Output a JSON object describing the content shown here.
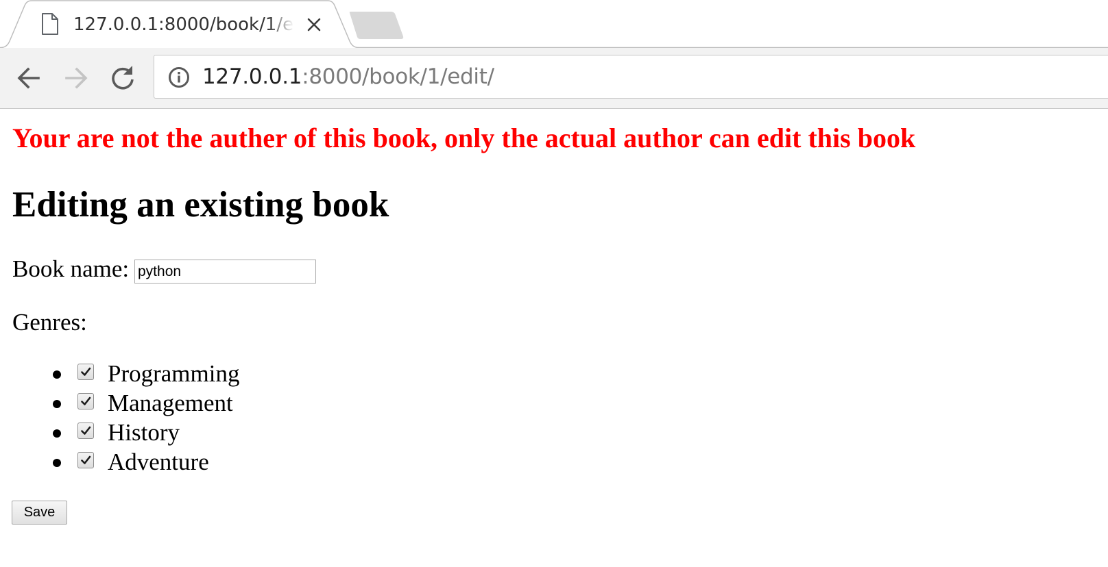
{
  "browser": {
    "tab": {
      "title": "127.0.0.1:8000/book/1/edit/",
      "icon": "file-icon",
      "close_icon": "close-icon"
    },
    "new_tab_icon": "new-tab-icon",
    "toolbar": {
      "back_icon": "back-arrow-icon",
      "forward_icon": "forward-arrow-icon",
      "reload_icon": "reload-icon"
    },
    "address_bar": {
      "info_icon": "info-icon",
      "url_host": "127.0.0.1",
      "url_rest": ":8000/book/1/edit/"
    }
  },
  "page": {
    "error_message": "Your are not the auther of this book, only the actual author can edit this book",
    "error_color": "#ff0000",
    "title": "Editing an existing book",
    "book_name_label": "Book name:",
    "book_name_value": "python",
    "genres_label": "Genres:",
    "genres": [
      {
        "label": "Programming",
        "checked": true
      },
      {
        "label": "Management",
        "checked": true
      },
      {
        "label": "History",
        "checked": true
      },
      {
        "label": "Adventure",
        "checked": true
      }
    ],
    "save_label": "Save"
  }
}
